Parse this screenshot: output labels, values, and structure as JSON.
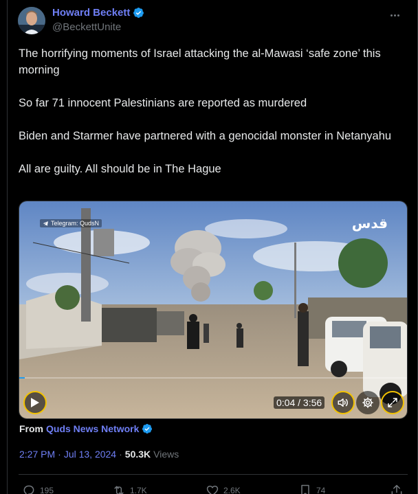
{
  "author": {
    "display_name": "Howard Beckett",
    "handle": "@BeckettUnite",
    "verified_icon": "verified-badge-icon"
  },
  "post": {
    "paragraphs": [
      "The horrifying moments of Israel attacking the al-Mawasi ‘safe zone’ this morning",
      "So far 71 innocent Palestinians are reported as murdered",
      "Biden and Starmer have partnered with a genocidal monster in Netanyahu",
      "All are guilty. All should be in The Hague"
    ]
  },
  "video": {
    "watermark_left": "Telegram: QudsN",
    "watermark_logo": "قدس",
    "time_display": "0:04 / 3:56",
    "accent_color": "#f2c200",
    "controls": [
      "play-icon",
      "volume-icon",
      "gear-icon",
      "fullscreen-icon"
    ]
  },
  "attribution": {
    "label": "From",
    "source": "Quds News Network"
  },
  "meta": {
    "time": "2:27 PM",
    "separator": "·",
    "date": "Jul 13, 2024",
    "views_count": "50.3K",
    "views_label": "Views"
  },
  "actions": {
    "replies": "195",
    "reposts": "1.7K",
    "likes": "2.6K",
    "bookmarks": "74"
  },
  "colors": {
    "link": "#6f7ff5",
    "muted": "#71767b",
    "text": "#e7e9ea",
    "background": "#000000",
    "verified": "#1d9bf0"
  }
}
